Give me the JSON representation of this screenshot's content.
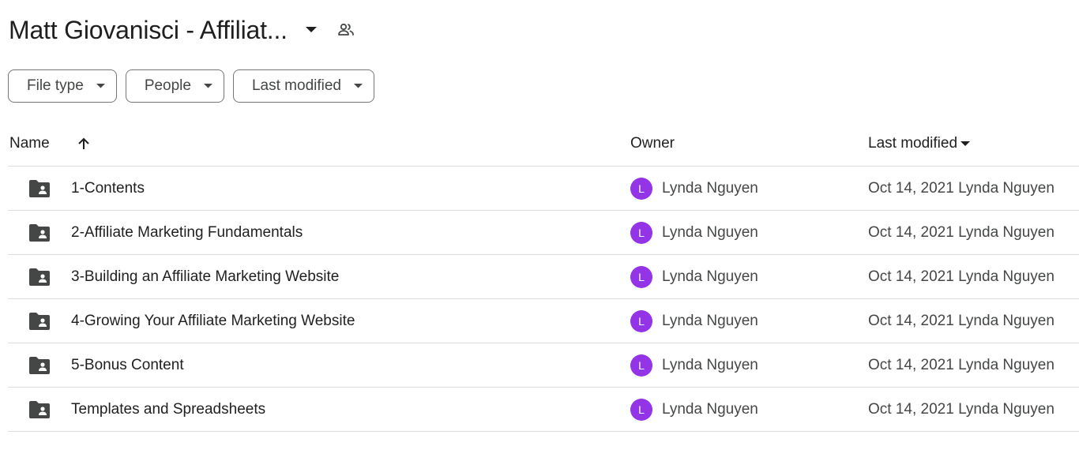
{
  "header": {
    "title": "Matt Giovanisci - Affiliat...",
    "dropdown_icon": "caret-down-icon",
    "shared_icon": "people-icon"
  },
  "filters": [
    {
      "label": "File type"
    },
    {
      "label": "People"
    },
    {
      "label": "Last modified"
    }
  ],
  "table": {
    "columns": {
      "name": "Name",
      "owner": "Owner",
      "modified": "Last modified"
    },
    "sort": {
      "column": "Name",
      "direction": "ascending"
    },
    "rows": [
      {
        "name": "1-Contents",
        "owner": "Lynda Nguyen",
        "owner_initial": "L",
        "modified": "Oct 14, 2021 Lynda Nguyen"
      },
      {
        "name": "2-Affiliate Marketing Fundamentals",
        "owner": "Lynda Nguyen",
        "owner_initial": "L",
        "modified": "Oct 14, 2021 Lynda Nguyen"
      },
      {
        "name": "3-Building an Affiliate Marketing Website",
        "owner": "Lynda Nguyen",
        "owner_initial": "L",
        "modified": "Oct 14, 2021 Lynda Nguyen"
      },
      {
        "name": "4-Growing Your Affiliate Marketing Website",
        "owner": "Lynda Nguyen",
        "owner_initial": "L",
        "modified": "Oct 14, 2021 Lynda Nguyen"
      },
      {
        "name": "5-Bonus Content",
        "owner": "Lynda Nguyen",
        "owner_initial": "L",
        "modified": "Oct 14, 2021 Lynda Nguyen"
      },
      {
        "name": "Templates and Spreadsheets",
        "owner": "Lynda Nguyen",
        "owner_initial": "L",
        "modified": "Oct 14, 2021 Lynda Nguyen"
      }
    ]
  },
  "colors": {
    "avatar": "#9334e6",
    "folder_icon": "#444746",
    "border": "#dadce0"
  }
}
